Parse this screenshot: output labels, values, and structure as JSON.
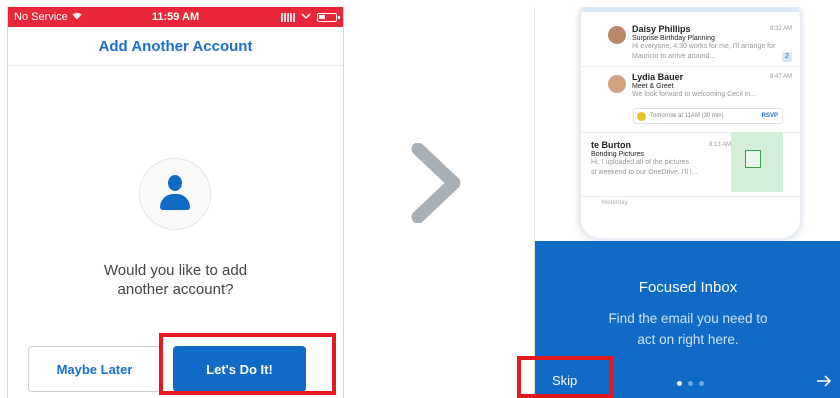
{
  "left": {
    "status_bar": {
      "carrier": "No Service",
      "time": "11:59 AM"
    },
    "title": "Add Another Account",
    "question": "Would you like to add\nanother account?",
    "buttons": {
      "maybe_later": "Maybe Later",
      "lets_do_it": "Let's Do It!"
    }
  },
  "right": {
    "preview": {
      "emails": [
        {
          "sender": "Daisy Phillips",
          "subject": "Surprise Birthday Planning",
          "preview": "Hi everyone, 4:30 works for me, I'll arrange for Mauricio to arrive around...",
          "time": "9:32 AM",
          "count": "2"
        },
        {
          "sender": "Lydia Bauer",
          "subject": "Meet & Greet",
          "preview": "We look forward to welcoming Cecil in...",
          "time": "8:47 AM",
          "event": "Tomorrow at 11AM (30 min)",
          "rsvp": "RSVP"
        },
        {
          "sender": "te Burton",
          "subject": "Bonding Pictures",
          "preview": "Hi, I uploaded all of the pictures\nst weekend to our OneDrive. I'll l...",
          "time": "8:13 AM"
        }
      ],
      "section_label": "Yesterday"
    },
    "panel": {
      "title": "Focused Inbox",
      "text": "Find the email you need to\nact on right here.",
      "skip": "Skip"
    }
  },
  "colors": {
    "brand_blue": "#0f6bc6",
    "status_red": "#e9273a",
    "highlight_red": "#e2191f",
    "arrow_gray": "#a9b0b5"
  }
}
